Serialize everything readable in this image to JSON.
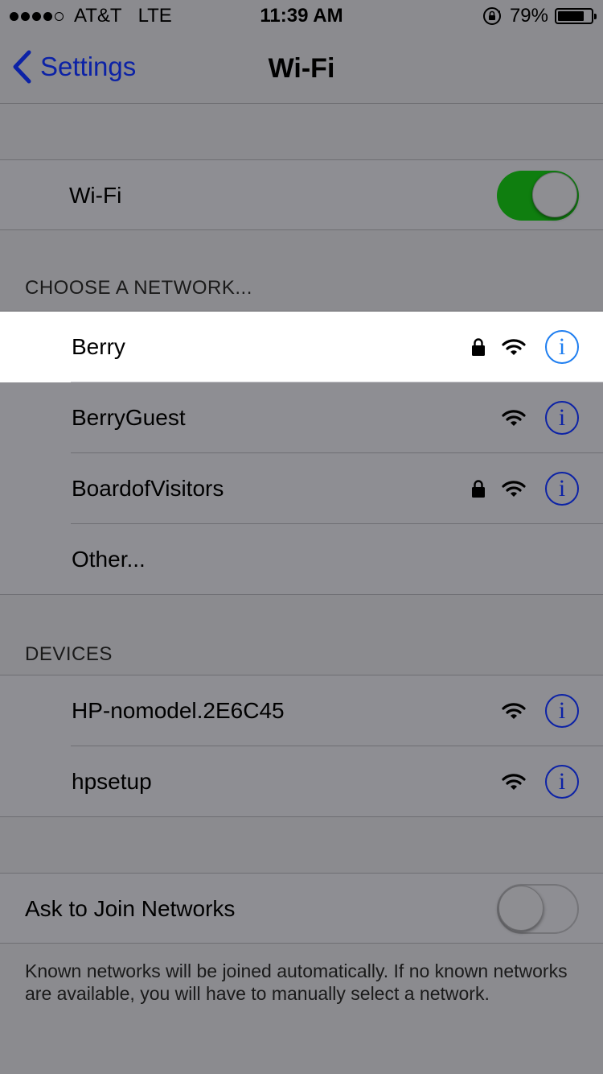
{
  "status_bar": {
    "carrier": "AT&T",
    "network": "LTE",
    "time": "11:39 AM",
    "battery": "79%",
    "battery_level": 0.79,
    "signal_bars": 4
  },
  "nav": {
    "back_label": "Settings",
    "title": "Wi-Fi"
  },
  "wifi_toggle": {
    "label": "Wi-Fi",
    "on": true
  },
  "networks_section": {
    "header": "CHOOSE A NETWORK...",
    "items": [
      {
        "name": "Berry",
        "locked": true,
        "selected": true
      },
      {
        "name": "BerryGuest",
        "locked": false
      },
      {
        "name": "BoardofVisitors",
        "locked": true
      },
      {
        "name": "Other..."
      }
    ]
  },
  "devices_section": {
    "header": "DEVICES",
    "items": [
      {
        "name": "HP-nomodel.2E6C45"
      },
      {
        "name": "hpsetup"
      }
    ]
  },
  "ask_to_join": {
    "label": "Ask to Join Networks",
    "on": false,
    "footer": "Known networks will be joined automatically. If no known networks are available, you will have to manually select a network."
  },
  "colors": {
    "accent": "#0c22a6",
    "toggle_on": "#0f7e0f",
    "selected_info": "#1f7ef0"
  }
}
